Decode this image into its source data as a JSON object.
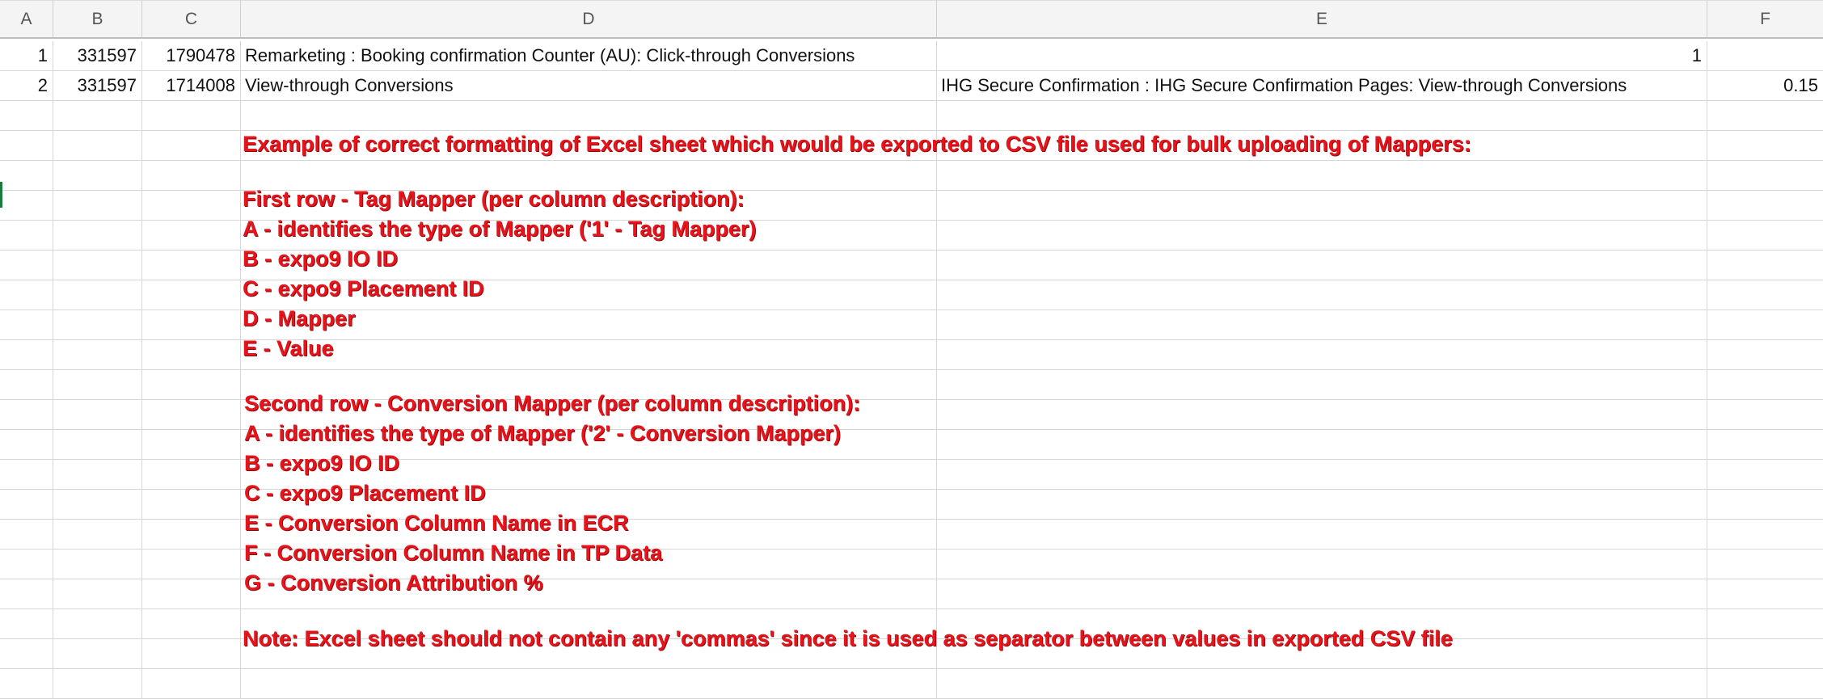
{
  "columns": [
    "A",
    "B",
    "C",
    "D",
    "E",
    "F"
  ],
  "rows": [
    {
      "a": "1",
      "b": "331597",
      "c": "1790478",
      "d": "Remarketing : Booking confirmation Counter (AU): Click-through Conversions",
      "e": "1",
      "f": ""
    },
    {
      "a": "2",
      "b": "331597",
      "c": "1714008",
      "d": "View-through Conversions",
      "e": "IHG Secure Confirmation : IHG Secure Confirmation Pages: View-through Conversions",
      "f": "0.15"
    }
  ],
  "notes": {
    "title": "Example of correct formatting of Excel sheet which would be exported to CSV file used for bulk uploading of Mappers:",
    "tag_mapper": {
      "heading": "First row - Tag Mapper (per column description):",
      "items": [
        "A - identifies the type of Mapper ('1' - Tag Mapper)",
        "B - expo9 IO ID",
        "C - expo9 Placement ID",
        "D - Mapper",
        "E - Value"
      ]
    },
    "conversion_mapper": {
      "heading": "Second row - Conversion Mapper (per column description):",
      "items": [
        "A - identifies the type of Mapper ('2' - Conversion Mapper)",
        "B - expo9 IO ID",
        "C - expo9 Placement ID",
        "E - Conversion Column Name in ECR",
        "F - Conversion Column Name in TP Data",
        "G - Conversion Attribution %"
      ]
    },
    "footer": "Note: Excel sheet should not contain any 'commas' since it is used as separator between values in exported CSV file"
  },
  "colors": {
    "note_text": "#e8141b",
    "header_bg": "#f4f4f4",
    "gridline": "#d6d6d6"
  }
}
